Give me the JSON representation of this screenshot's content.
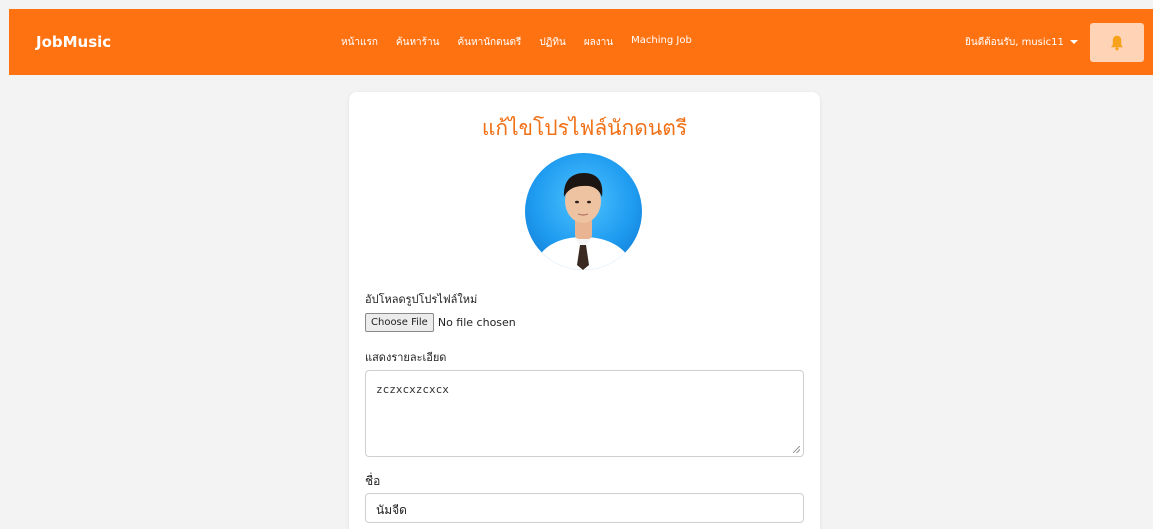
{
  "nav": {
    "brand": "JobMusic",
    "links": [
      "หน้าแรก",
      "ค้นหาร้าน",
      "ค้นหานักดนตรี",
      "ปฏิทิน",
      "ผลงาน",
      "Maching Job"
    ],
    "user_greeting": "ยินดีต้อนรับ, music11",
    "bell_icon": "bell-icon",
    "colors": {
      "bar": "#ff7212",
      "bell_bg": "#ffd3b5",
      "bell": "#f7a21b"
    }
  },
  "form": {
    "title": "แก้ไขโปรไฟล์นักดนตรี",
    "upload_label": "อัปโหลดรูปโปรไฟล์ใหม่",
    "file_button": "Choose File",
    "file_status": "No file chosen",
    "description_label": "แสดงรายละเอียด",
    "description_value": "zczxcxzcxcx",
    "name_label": "ชื่อ",
    "name_value": "นัมจีด",
    "title_color": "#f07016"
  }
}
